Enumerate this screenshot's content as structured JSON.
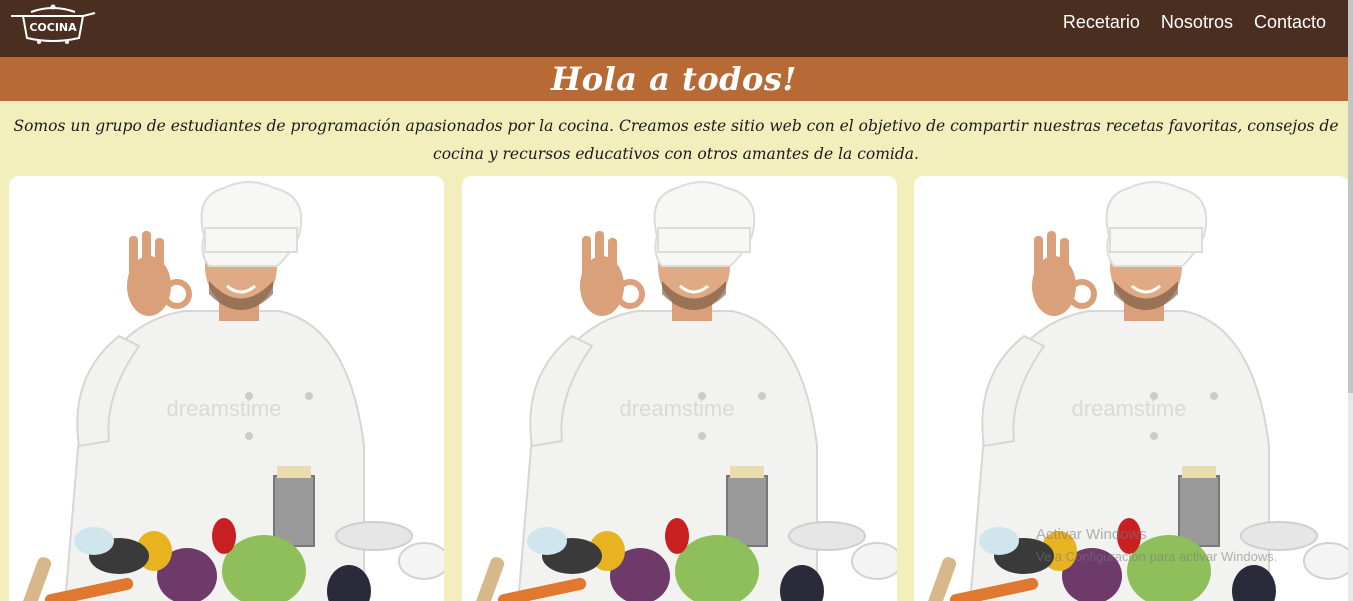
{
  "header": {
    "logo_text": "COCINA",
    "nav": [
      "Recetario",
      "Nosotros",
      "Contacto"
    ]
  },
  "banner": {
    "title": "Hola a todos!"
  },
  "intro": {
    "text": "Somos un grupo de estudiantes de programación apasionados por la cocina. Creamos este sitio web con el objetivo de compartir nuestras recetas favoritas, consejos de cocina y recursos educativos con otros amantes de la comida."
  },
  "cards": [
    {
      "image": "chef-ok-gesture-with-vegetables",
      "watermark": "dreamstime"
    },
    {
      "image": "chef-ok-gesture-with-vegetables",
      "watermark": "dreamstime"
    },
    {
      "image": "chef-ok-gesture-with-vegetables",
      "watermark": "dreamstime"
    }
  ],
  "os_watermark": {
    "line1": "Activar Windows",
    "line2": "Ve a Configuración para activar Windows."
  },
  "colors": {
    "topbar": "#4a2e20",
    "banner": "#b86a35",
    "background": "#f3efbd",
    "card": "#ffffff"
  }
}
